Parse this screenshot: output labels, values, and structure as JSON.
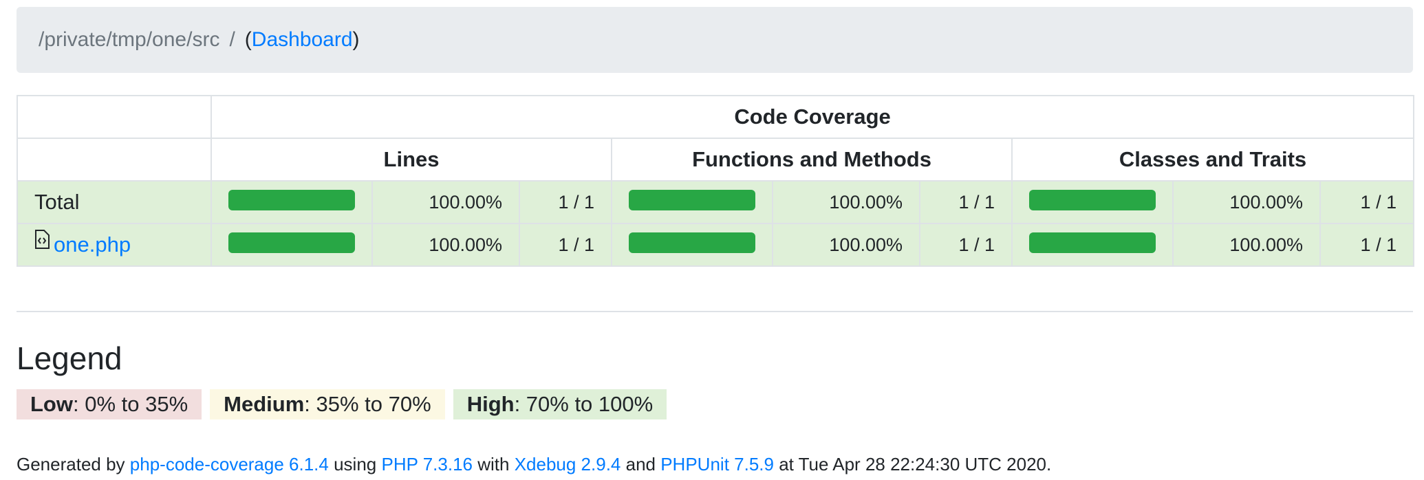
{
  "breadcrumb": {
    "path": "/private/tmp/one/src",
    "separator": "/",
    "open_paren": "(",
    "dashboard_label": "Dashboard",
    "close_paren": ")"
  },
  "table": {
    "group_header": "Code Coverage",
    "columns": [
      "Lines",
      "Functions and Methods",
      "Classes and Traits"
    ],
    "rows": [
      {
        "name": "Total",
        "is_file": false,
        "lines": {
          "percent": "100.00%",
          "ratio": "1 / 1",
          "fill": 1.0
        },
        "functions": {
          "percent": "100.00%",
          "ratio": "1 / 1",
          "fill": 1.0
        },
        "classes": {
          "percent": "100.00%",
          "ratio": "1 / 1",
          "fill": 1.0
        }
      },
      {
        "name": "one.php",
        "is_file": true,
        "lines": {
          "percent": "100.00%",
          "ratio": "1 / 1",
          "fill": 1.0
        },
        "functions": {
          "percent": "100.00%",
          "ratio": "1 / 1",
          "fill": 1.0
        },
        "classes": {
          "percent": "100.00%",
          "ratio": "1 / 1",
          "fill": 1.0
        }
      }
    ],
    "colors": {
      "high_bg": "#dff0d8",
      "bar": "#28a745"
    }
  },
  "legend": {
    "title": "Legend",
    "low_label": "Low",
    "low_range": ": 0% to 35%",
    "medium_label": "Medium",
    "medium_range": ": 35% to 70%",
    "high_label": "High",
    "high_range": ": 70% to 100%",
    "colors": {
      "low": "#f2dede",
      "medium": "#fcf8e3",
      "high": "#dff0d8"
    }
  },
  "footer": {
    "generated_by": "Generated by ",
    "tool": "php-code-coverage 6.1.4",
    "using": " using ",
    "php": "PHP 7.3.16",
    "with": " with ",
    "xdebug": "Xdebug 2.9.4",
    "and": " and ",
    "phpunit": "PHPUnit 7.5.9",
    "at": " at Tue Apr 28 22:24:30 UTC 2020."
  }
}
